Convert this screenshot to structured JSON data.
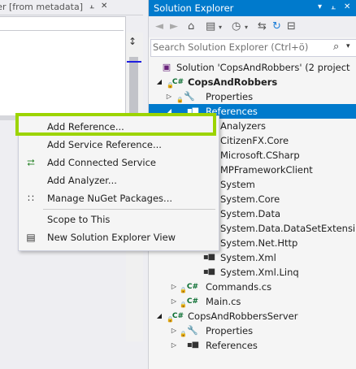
{
  "left_pane": {
    "tab_title": "xer [from metadata]",
    "tab_buttons": [
      "pin-icon",
      "close-icon"
    ]
  },
  "solution_explorer": {
    "title": "Solution Explorer",
    "search_placeholder": "Search Solution Explorer (Ctrl+ö)",
    "toolbar_icons": [
      "back-icon",
      "forward-icon",
      "home-icon",
      "switch-views-icon",
      "chevron-down-icon",
      "pending-changes-icon",
      "chevron-down-icon",
      "sync-icon",
      "refresh-icon",
      "collapse-all-icon"
    ],
    "accent_color": "#007acc",
    "tree": [
      {
        "label": "Solution 'CopsAndRobbers' (2 project",
        "icon": "solution-icon"
      },
      {
        "label": "CopsAndRobbers",
        "icon": "csharp-project-icon"
      },
      {
        "label": "Properties",
        "icon": "wrench-icon"
      },
      {
        "label": "References",
        "icon": "references-icon"
      },
      {
        "label": "Analyzers",
        "icon": "analyzer-icon"
      },
      {
        "label": "CitizenFX.Core",
        "icon": "reference-icon"
      },
      {
        "label": "Microsoft.CSharp",
        "icon": "reference-icon"
      },
      {
        "label": "MPFrameworkClient",
        "icon": "reference-icon"
      },
      {
        "label": "System",
        "icon": "reference-icon"
      },
      {
        "label": "System.Core",
        "icon": "reference-icon"
      },
      {
        "label": "System.Data",
        "icon": "reference-icon"
      },
      {
        "label": "System.Data.DataSetExtensi",
        "icon": "reference-icon"
      },
      {
        "label": "System.Net.Http",
        "icon": "reference-icon"
      },
      {
        "label": "System.Xml",
        "icon": "reference-icon"
      },
      {
        "label": "System.Xml.Linq",
        "icon": "reference-icon"
      },
      {
        "label": "Commands.cs",
        "icon": "csharp-file-icon"
      },
      {
        "label": "Main.cs",
        "icon": "csharp-file-icon"
      },
      {
        "label": "CopsAndRobbersServer",
        "icon": "csharp-project-icon"
      },
      {
        "label": "Properties",
        "icon": "wrench-icon"
      },
      {
        "label": "References",
        "icon": "references-icon"
      }
    ]
  },
  "context_menu": {
    "highlight_color": "#9cd400",
    "items": [
      {
        "label": "Add Reference...",
        "icon": ""
      },
      {
        "label": "Add Service Reference...",
        "icon": ""
      },
      {
        "label": "Add Connected Service",
        "icon": "connected-service-icon"
      },
      {
        "label": "Add Analyzer...",
        "icon": ""
      },
      {
        "label": "Manage NuGet Packages...",
        "icon": "nuget-icon"
      },
      {
        "label": "Scope to This",
        "icon": ""
      },
      {
        "label": "New Solution Explorer View",
        "icon": "new-view-icon"
      }
    ]
  }
}
